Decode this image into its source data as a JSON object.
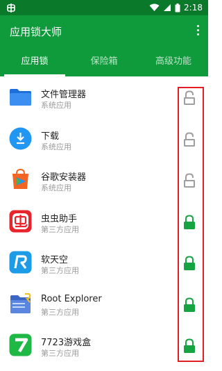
{
  "status_bar": {
    "time": "2:18"
  },
  "app_bar": {
    "title": "应用锁大师"
  },
  "tabs": [
    {
      "label": "应用锁",
      "active": true
    },
    {
      "label": "保险箱",
      "active": false
    },
    {
      "label": "高级功能",
      "active": false
    }
  ],
  "apps": [
    {
      "name": "文件管理器",
      "type": "系统应用",
      "icon": "folder-icon",
      "locked": false
    },
    {
      "name": "下载",
      "type": "系统应用",
      "icon": "download-icon",
      "locked": false
    },
    {
      "name": "谷歌安装器",
      "type": "系统应用",
      "icon": "google-installer-icon",
      "locked": false
    },
    {
      "name": "虫虫助手",
      "type": "第三方应用",
      "icon": "chongchong-icon",
      "locked": true
    },
    {
      "name": "软天空",
      "type": "第三方应用",
      "icon": "ruantiankong-icon",
      "locked": true
    },
    {
      "name": "Root Explorer",
      "type": "第三方应用",
      "icon": "root-explorer-icon",
      "locked": true
    },
    {
      "name": "7723游戏盒",
      "type": "第三方应用",
      "icon": "7723-icon",
      "locked": true
    }
  ],
  "colors": {
    "status_bar": "#0a7a2a",
    "primary": "#0f9a3c",
    "lock_locked": "#16a341",
    "lock_unlocked": "#9e9e9e",
    "highlight": "#e31d22"
  }
}
